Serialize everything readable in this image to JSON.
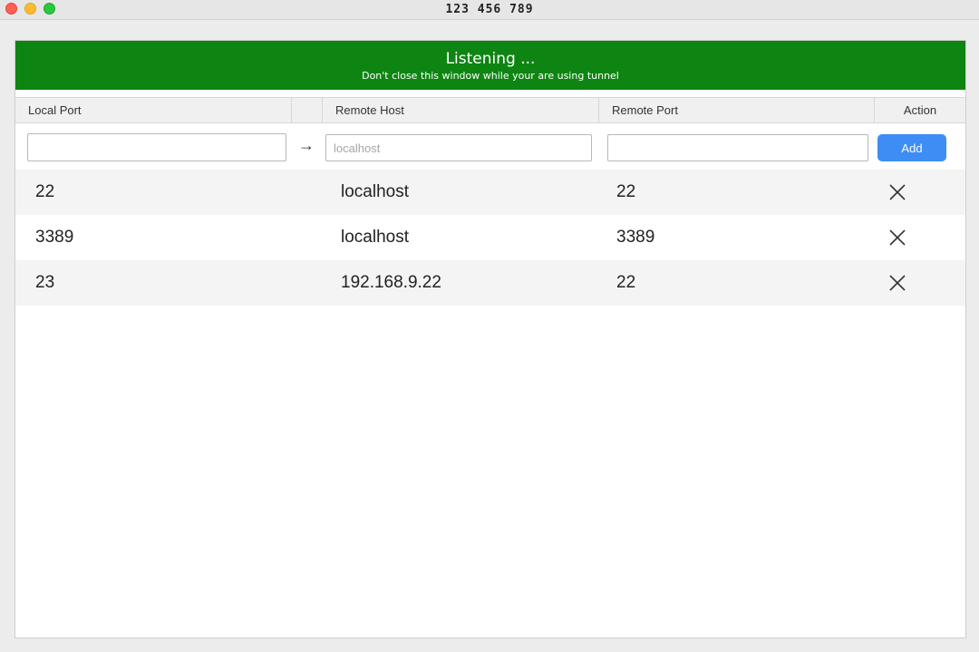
{
  "window": {
    "title": "123 456 789"
  },
  "banner": {
    "title": "Listening ...",
    "subtitle": "Don't close this window while your are using tunnel",
    "color": "#0e8512"
  },
  "table": {
    "headers": {
      "local_port": "Local Port",
      "arrow_col": "",
      "remote_host": "Remote Host",
      "remote_port": "Remote Port",
      "action": "Action"
    }
  },
  "form": {
    "local_port_value": "",
    "local_port_placeholder": "",
    "arrow_icon": "arrow-right-icon",
    "remote_host_value": "",
    "remote_host_placeholder": "localhost",
    "remote_port_value": "",
    "remote_port_placeholder": "",
    "add_label": "Add",
    "add_color": "#3d8df5"
  },
  "rows": [
    {
      "local_port": "22",
      "remote_host": "localhost",
      "remote_port": "22",
      "action_icon": "close-icon"
    },
    {
      "local_port": "3389",
      "remote_host": "localhost",
      "remote_port": "3389",
      "action_icon": "close-icon"
    },
    {
      "local_port": "23",
      "remote_host": "192.168.9.22",
      "remote_port": "22",
      "action_icon": "close-icon"
    }
  ]
}
